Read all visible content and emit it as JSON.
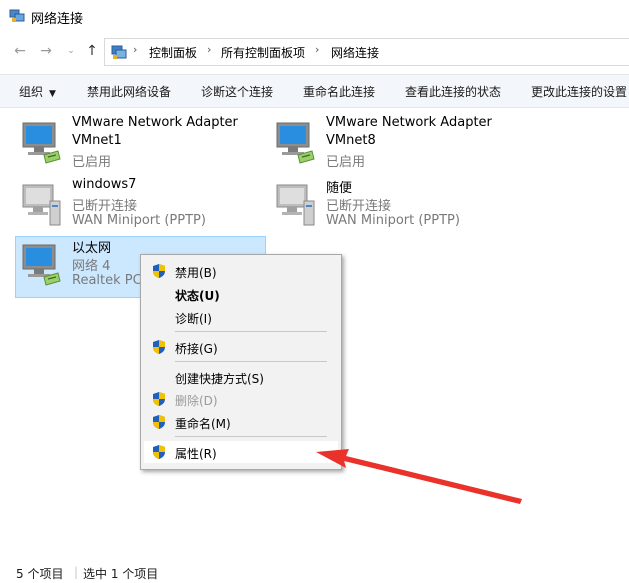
{
  "window": {
    "title": "网络连接"
  },
  "address": {
    "crumbs": [
      "控制面板",
      "所有控制面板项",
      "网络连接"
    ]
  },
  "commands": {
    "organize": "组织",
    "disable": "禁用此网络设备",
    "diagnose": "诊断这个连接",
    "rename": "重命名此连接",
    "status": "查看此连接的状态",
    "change": "更改此连接的设置"
  },
  "items": [
    {
      "name": "VMware Network Adapter",
      "sub": "VMnet1",
      "status": "已启用",
      "icon": "network-adapter-icon"
    },
    {
      "name": "VMware Network Adapter",
      "sub": "VMnet8",
      "status": "已启用",
      "icon": "network-adapter-icon"
    },
    {
      "name": "windows7",
      "sub": "已断开连接",
      "status": "WAN Miniport (PPTP)",
      "icon": "vpn-connection-icon"
    },
    {
      "name": "随便",
      "sub": "已断开连接",
      "status": "WAN Miniport (PPTP)",
      "icon": "vpn-connection-icon"
    },
    {
      "name": "以太网",
      "sub": "网络 4",
      "status": "Realtek PCI",
      "icon": "network-adapter-icon"
    }
  ],
  "context_menu": {
    "disable": "禁用(B)",
    "status": "状态(U)",
    "diagnose": "诊断(I)",
    "bridge": "桥接(G)",
    "shortcut": "创建快捷方式(S)",
    "delete": "删除(D)",
    "rename": "重命名(M)",
    "properties": "属性(R)"
  },
  "status_bar": {
    "count": "5 个项目",
    "selected": "选中 1 个项目"
  },
  "colors": {
    "selection": "#cce8ff",
    "annotation_arrow": "#e8322a",
    "shield_blue": "#1f5fbf",
    "shield_yellow": "#f2c200"
  }
}
